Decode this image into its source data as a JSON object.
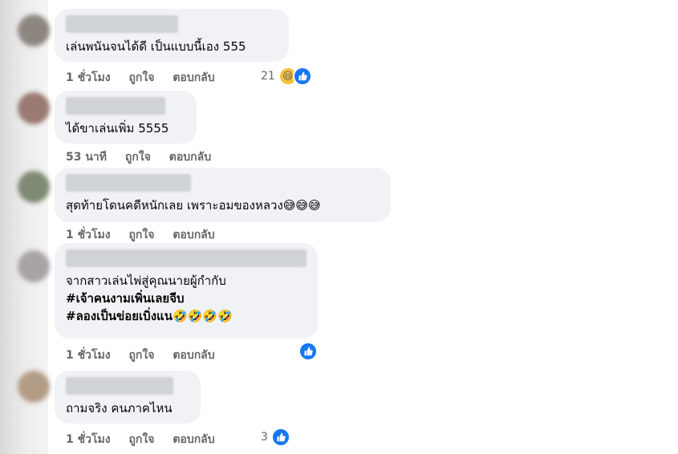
{
  "comments": [
    {
      "text": "เล่นพนันจนได้ดี เป็นแบบนี้เอง 555",
      "time": "1 ชั่วโมง",
      "like": "ถูกใจ",
      "reply": "ตอบกลับ",
      "reaction_count": "21"
    },
    {
      "text": "ได้ขาเล่นเพิ่ม 5555",
      "time": "53 นาที",
      "like": "ถูกใจ",
      "reply": "ตอบกลับ"
    },
    {
      "text": "สุดท้ายโดนคดีหนักเลย เพราะอมของหลวง😅😅😅",
      "time": "1 ชั่วโมง",
      "like": "ถูกใจ",
      "reply": "ตอบกลับ"
    },
    {
      "line1": "จากสาวเล่นไพ่สู่คุณนายผู้กำกับ",
      "line2": "#เจ้าคนงามเพิ่นเลยจีบ",
      "line3": "#ลองเป็นข่อยเบิ่งแน🤣🤣🤣🤣",
      "time": "1 ชั่วโมง",
      "like": "ถูกใจ",
      "reply": "ตอบกลับ"
    },
    {
      "text": "ถามจริง คนภาคไหน",
      "time": "1 ชั่วโมง",
      "like": "ถูกใจ",
      "reply": "ตอบกลับ",
      "reaction_count": "3"
    }
  ],
  "icons": {
    "haha": "haha-reaction-icon",
    "like": "like-reaction-icon"
  },
  "colors": {
    "bubble": "#f0f2f5",
    "meta_text": "#65676b",
    "like_blue": "#1877f2"
  }
}
